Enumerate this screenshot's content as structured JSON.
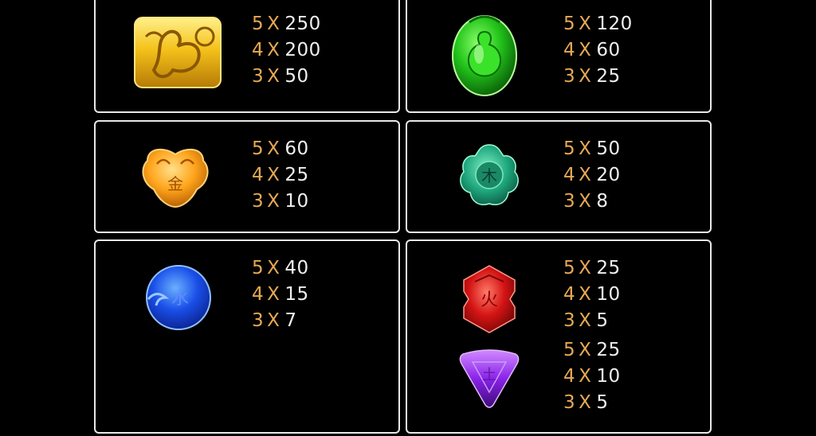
{
  "colors": {
    "count": "#e7a955",
    "value": "#f0f0f0",
    "border": "#e8e8e8",
    "background": "#000000"
  },
  "symbols": [
    {
      "name": "gold-dragon-icon",
      "pays": [
        {
          "count": "5",
          "sep": "X",
          "value": "250"
        },
        {
          "count": "4",
          "sep": "X",
          "value": "200"
        },
        {
          "count": "3",
          "sep": "X",
          "value": "50"
        }
      ]
    },
    {
      "name": "green-gourd-icon",
      "pays": [
        {
          "count": "5",
          "sep": "X",
          "value": "120"
        },
        {
          "count": "4",
          "sep": "X",
          "value": "60"
        },
        {
          "count": "3",
          "sep": "X",
          "value": "25"
        }
      ]
    },
    {
      "name": "orange-metal-icon",
      "glyph": "金",
      "pays": [
        {
          "count": "5",
          "sep": "X",
          "value": "60"
        },
        {
          "count": "4",
          "sep": "X",
          "value": "25"
        },
        {
          "count": "3",
          "sep": "X",
          "value": "10"
        }
      ]
    },
    {
      "name": "teal-wood-icon",
      "glyph": "木",
      "pays": [
        {
          "count": "5",
          "sep": "X",
          "value": "50"
        },
        {
          "count": "4",
          "sep": "X",
          "value": "20"
        },
        {
          "count": "3",
          "sep": "X",
          "value": "8"
        }
      ]
    },
    {
      "name": "blue-water-icon",
      "glyph": "水",
      "pays": [
        {
          "count": "5",
          "sep": "X",
          "value": "40"
        },
        {
          "count": "4",
          "sep": "X",
          "value": "15"
        },
        {
          "count": "3",
          "sep": "X",
          "value": "7"
        }
      ]
    },
    {
      "name": "red-fire-icon",
      "glyph": "火",
      "pays": [
        {
          "count": "5",
          "sep": "X",
          "value": "25"
        },
        {
          "count": "4",
          "sep": "X",
          "value": "10"
        },
        {
          "count": "3",
          "sep": "X",
          "value": "5"
        }
      ]
    },
    {
      "name": "purple-earth-icon",
      "glyph": "土",
      "pays": [
        {
          "count": "5",
          "sep": "X",
          "value": "25"
        },
        {
          "count": "4",
          "sep": "X",
          "value": "10"
        },
        {
          "count": "3",
          "sep": "X",
          "value": "5"
        }
      ]
    }
  ]
}
